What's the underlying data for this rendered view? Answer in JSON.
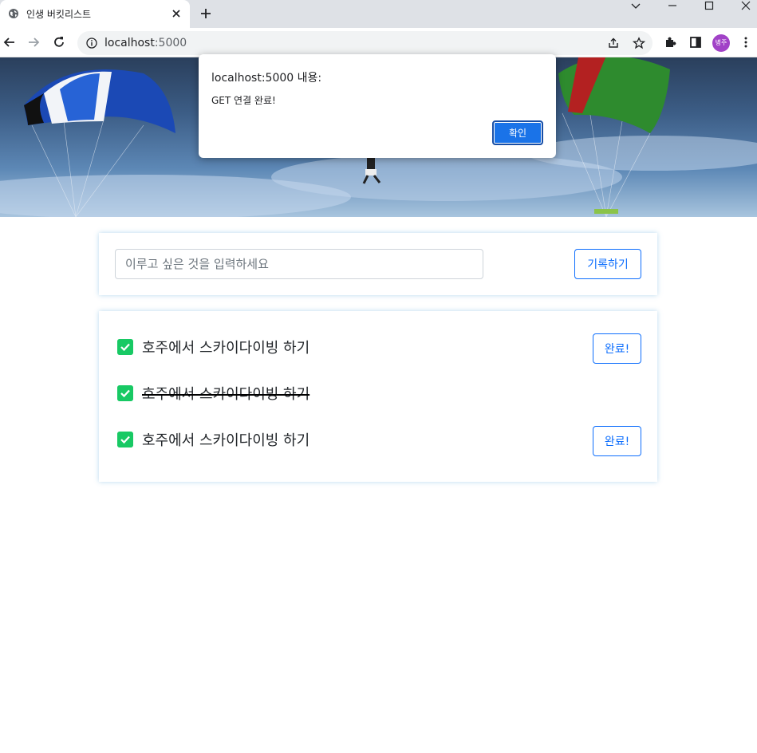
{
  "browser": {
    "tab_title": "인생 버킷리스트",
    "url_host": "localhost",
    "url_port": ":5000",
    "profile_initials": "병주"
  },
  "form": {
    "placeholder": "이루고 싶은 것을 입력하세요",
    "save_label": "기록하기"
  },
  "bucket_list": [
    {
      "text": "호주에서 스카이다이빙 하기",
      "done": false,
      "button_label": "완료!"
    },
    {
      "text": "호주에서 스카이다이빙 하기",
      "done": true,
      "button_label": ""
    },
    {
      "text": "호주에서 스카이다이빙 하기",
      "done": false,
      "button_label": "완료!"
    }
  ],
  "dialog": {
    "title": "localhost:5000 내용:",
    "message": "GET 연결 완료!",
    "ok_label": "확인"
  },
  "colors": {
    "accent": "#0d6efd",
    "check": "#18c964",
    "dialog_button": "#1a73e8"
  }
}
